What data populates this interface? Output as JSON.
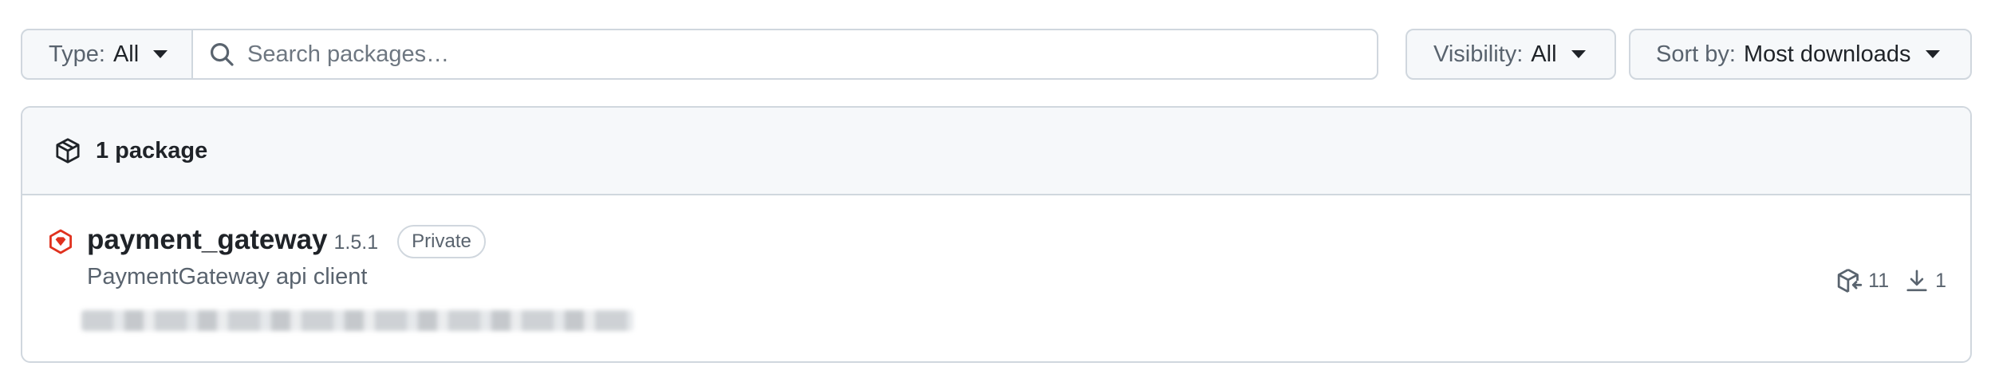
{
  "filters": {
    "type_label": "Type:",
    "type_value": "All",
    "search_placeholder": "Search packages…",
    "visibility_label": "Visibility:",
    "visibility_value": "All",
    "sort_label": "Sort by:",
    "sort_value": "Most downloads"
  },
  "results": {
    "count_label": "1 package",
    "packages": [
      {
        "name": "payment_gateway",
        "version": "1.5.1",
        "visibility_badge": "Private",
        "description": "PaymentGateway api client",
        "versions_count": "11",
        "downloads_count": "1"
      }
    ]
  },
  "icons": {
    "search": "search-icon",
    "package_box": "package-icon",
    "ruby_gem": "rubygems-icon",
    "versions": "package-versions-icon",
    "download": "download-icon",
    "dropdown": "triangle-down-icon"
  },
  "colors": {
    "border": "#d0d7de",
    "header_bg": "#f6f8fa",
    "text": "#1f2328",
    "muted": "#59636e",
    "ruby_red": "#e0311e"
  }
}
